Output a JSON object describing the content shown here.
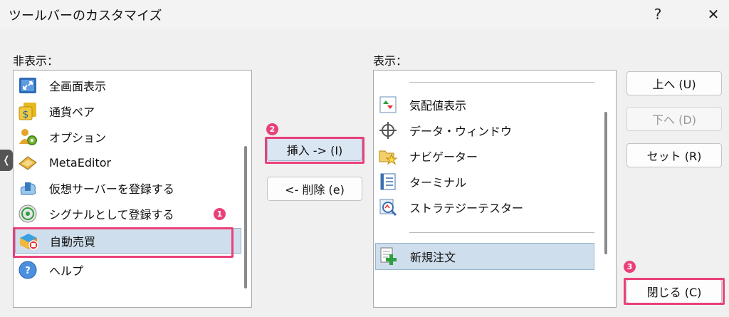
{
  "window": {
    "title": "ツールバーのカスタマイズ",
    "help_label": "?",
    "close_label": "✕"
  },
  "hidden": {
    "label": "非表示：",
    "items": [
      {
        "label": "全画面表示",
        "icon": "fullscreen-icon"
      },
      {
        "label": "通貨ペア",
        "icon": "currency-pair-icon"
      },
      {
        "label": "オプション",
        "icon": "options-icon"
      },
      {
        "label": "MetaEditor",
        "icon": "metaeditor-icon"
      },
      {
        "label": "仮想サーバーを登録する",
        "icon": "virtual-server-icon"
      },
      {
        "label": "シグナルとして登録する",
        "icon": "signal-icon"
      },
      {
        "label": "自動売買",
        "icon": "auto-trading-icon",
        "selected": true
      },
      {
        "label": "ヘルプ",
        "icon": "help-icon"
      }
    ]
  },
  "shown": {
    "label": "表示：",
    "items": [
      {
        "label": "気配値表示",
        "icon": "market-watch-icon"
      },
      {
        "label": "データ・ウィンドウ",
        "icon": "data-window-icon"
      },
      {
        "label": "ナビゲーター",
        "icon": "navigator-icon"
      },
      {
        "label": "ターミナル",
        "icon": "terminal-icon"
      },
      {
        "label": "ストラテジーテスター",
        "icon": "strategy-tester-icon"
      },
      {
        "label": "新規注文",
        "icon": "new-order-icon",
        "selected": true
      }
    ]
  },
  "buttons": {
    "insert": "挿入 -> (I)",
    "remove": "<- 削除 (e)",
    "up": "上へ (U)",
    "down": "下へ (D)",
    "reset": "セット (R)",
    "close": "閉じる (C)"
  },
  "badges": {
    "one": "1",
    "two": "2",
    "three": "3"
  },
  "side_tab": "❬",
  "colors": {
    "highlight": "#e9407a",
    "selection": "#cfdeec"
  }
}
